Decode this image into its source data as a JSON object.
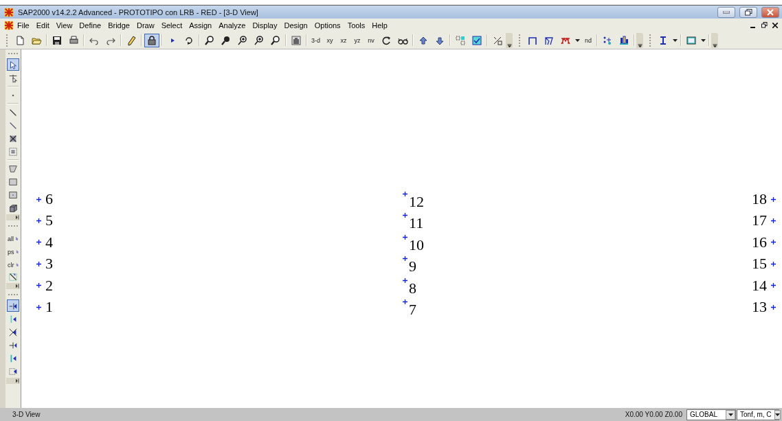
{
  "window": {
    "title": "SAP2000 v14.2.2 Advanced  - PROTOTIPO con LRB - RED - [3-D View]"
  },
  "menu": [
    "File",
    "Edit",
    "View",
    "Define",
    "Bridge",
    "Draw",
    "Select",
    "Assign",
    "Analyze",
    "Display",
    "Design",
    "Options",
    "Tools",
    "Help"
  ],
  "toolbar": [
    {
      "kind": "grip"
    },
    {
      "kind": "icon",
      "selected": false
    },
    {
      "kind": "icon",
      "selected": false
    },
    {
      "kind": "sep"
    },
    {
      "kind": "icon",
      "selected": false
    },
    {
      "kind": "icon",
      "selected": false
    },
    {
      "kind": "sep"
    },
    {
      "kind": "icon",
      "selected": false
    },
    {
      "kind": "icon",
      "selected": false
    },
    {
      "kind": "sep"
    },
    {
      "kind": "icon",
      "selected": false
    },
    {
      "kind": "sep"
    },
    {
      "kind": "icon",
      "selected": true
    },
    {
      "kind": "sep"
    },
    {
      "kind": "icon",
      "selected": false
    },
    {
      "kind": "icon",
      "selected": false
    },
    {
      "kind": "sep"
    },
    {
      "kind": "icon",
      "selected": false
    },
    {
      "kind": "icon",
      "selected": false
    },
    {
      "kind": "icon",
      "selected": false
    },
    {
      "kind": "icon",
      "selected": false
    },
    {
      "kind": "icon",
      "selected": false
    },
    {
      "kind": "sep"
    },
    {
      "kind": "icon",
      "selected": false
    },
    {
      "kind": "sep"
    },
    {
      "kind": "text",
      "label": "3-d"
    },
    {
      "kind": "text",
      "label": "xy"
    },
    {
      "kind": "text",
      "label": "xz"
    },
    {
      "kind": "text",
      "label": "yz"
    },
    {
      "kind": "text",
      "label": "nv"
    },
    {
      "kind": "icon",
      "selected": false
    },
    {
      "kind": "icon",
      "selected": false
    },
    {
      "kind": "sep"
    },
    {
      "kind": "icon",
      "selected": false
    },
    {
      "kind": "icon",
      "selected": false
    },
    {
      "kind": "sep"
    },
    {
      "kind": "icon",
      "selected": false
    },
    {
      "kind": "icon",
      "selected": false
    },
    {
      "kind": "sep"
    },
    {
      "kind": "icon",
      "selected": false
    },
    {
      "kind": "end"
    },
    {
      "kind": "grip"
    },
    {
      "kind": "icon",
      "selected": false
    },
    {
      "kind": "icon",
      "selected": false
    },
    {
      "kind": "icon",
      "selected": false
    },
    {
      "kind": "dropdown"
    },
    {
      "kind": "text",
      "label": "nd"
    },
    {
      "kind": "sep"
    },
    {
      "kind": "icon",
      "selected": false
    },
    {
      "kind": "icon",
      "selected": false
    },
    {
      "kind": "sep"
    },
    {
      "kind": "end"
    },
    {
      "kind": "grip"
    },
    {
      "kind": "icon",
      "selected": false
    },
    {
      "kind": "dropdown"
    },
    {
      "kind": "sep"
    },
    {
      "kind": "icon",
      "selected": false
    },
    {
      "kind": "dropdown"
    },
    {
      "kind": "sep"
    },
    {
      "kind": "end"
    }
  ],
  "side_toolbar": [
    {
      "kind": "grip"
    },
    {
      "kind": "icon",
      "selected": true
    },
    {
      "kind": "icon",
      "selected": false
    },
    {
      "kind": "sep"
    },
    {
      "kind": "icon",
      "selected": false
    },
    {
      "kind": "sep"
    },
    {
      "kind": "icon",
      "selected": false
    },
    {
      "kind": "icon",
      "selected": false
    },
    {
      "kind": "icon",
      "selected": false
    },
    {
      "kind": "icon",
      "selected": false
    },
    {
      "kind": "sep"
    },
    {
      "kind": "icon",
      "selected": false
    },
    {
      "kind": "icon",
      "selected": false
    },
    {
      "kind": "icon",
      "selected": false
    },
    {
      "kind": "icon",
      "selected": false
    },
    {
      "kind": "end"
    },
    {
      "kind": "grip"
    },
    {
      "kind": "text",
      "label": "all"
    },
    {
      "kind": "text",
      "label": "ps"
    },
    {
      "kind": "text",
      "label": "clr"
    },
    {
      "kind": "icon",
      "selected": false
    },
    {
      "kind": "end"
    },
    {
      "kind": "grip"
    },
    {
      "kind": "icon",
      "selected": true
    },
    {
      "kind": "icon",
      "selected": false
    },
    {
      "kind": "icon",
      "selected": false
    },
    {
      "kind": "icon",
      "selected": false
    },
    {
      "kind": "icon",
      "selected": false
    },
    {
      "kind": "icon",
      "selected": false
    },
    {
      "kind": "end"
    }
  ],
  "joints": [
    {
      "kind": "label-right",
      "labels": [
        "6",
        "5",
        "4",
        "3",
        "2",
        "1"
      ]
    },
    {
      "kind": "label-below",
      "labels": [
        "12",
        "11",
        "10",
        "9",
        "8",
        "7"
      ]
    },
    {
      "kind": "label-left",
      "labels": [
        "18",
        "17",
        "16",
        "15",
        "14",
        "13"
      ]
    }
  ],
  "status_bar": {
    "view": "3-D View",
    "coordinates": "X0.00 Y0.00 Z0.00",
    "coordinate_system": "GLOBAL",
    "units": "Tonf, m, C"
  }
}
